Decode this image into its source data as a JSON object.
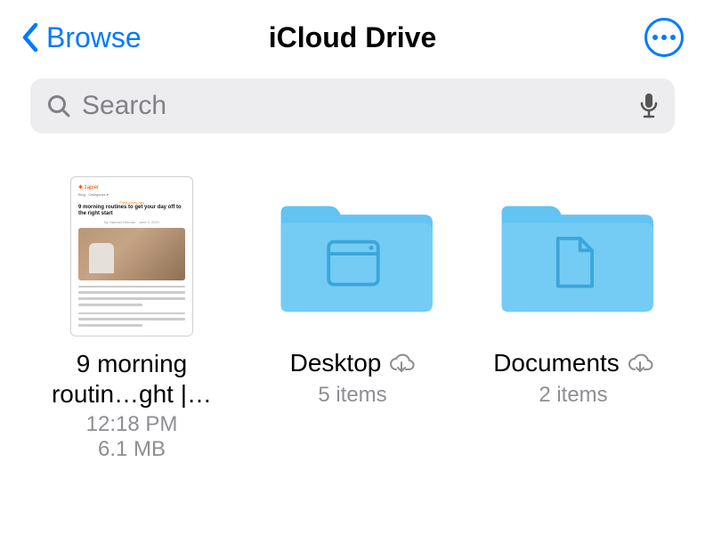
{
  "nav": {
    "back_label": "Browse",
    "title": "iCloud Drive"
  },
  "search": {
    "placeholder": "Search"
  },
  "items": [
    {
      "kind": "file",
      "name_line1": "9 morning",
      "name_line2": "routin…ght |…",
      "time": "12:18 PM",
      "size": "6.1 MB",
      "thumb_headline": "9 morning routines to get your day off to the right start"
    },
    {
      "kind": "folder",
      "name": "Desktop",
      "glyph": "window",
      "count_label": "5 items",
      "cloud": true
    },
    {
      "kind": "folder",
      "name": "Documents",
      "glyph": "document",
      "count_label": "2 items",
      "cloud": true
    }
  ]
}
